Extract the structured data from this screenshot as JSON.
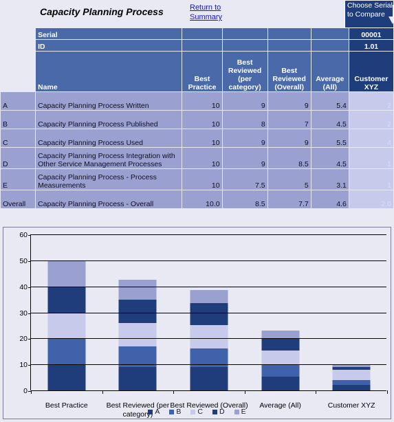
{
  "header": {
    "title": "Capacity Planning Process",
    "return_link": "Return to Summary",
    "choose_box_label": "Choose Serial to Compare",
    "arrow_icon": "arrow-down-icon"
  },
  "table": {
    "serial_row": {
      "label": "Serial",
      "value": "00001"
    },
    "id_row": {
      "label": "ID",
      "value": "1.01"
    },
    "columns": [
      {
        "key": "key",
        "label": ""
      },
      {
        "key": "name",
        "label": "Name"
      },
      {
        "key": "best_practice",
        "label": "Best Practice"
      },
      {
        "key": "best_reviewed_category",
        "label": "Best Reviewed (per category)"
      },
      {
        "key": "best_reviewed_overall",
        "label": "Best Reviewed (Overall)"
      },
      {
        "key": "average_all",
        "label": "Average (All)"
      },
      {
        "key": "customer_xyz",
        "label": "Customer XYZ"
      }
    ],
    "rows": [
      {
        "key": "A",
        "name": "Capacity Planning Process Written",
        "best_practice": "10",
        "best_reviewed_category": "9",
        "best_reviewed_overall": "9",
        "average_all": "5.4",
        "customer_xyz": "2"
      },
      {
        "key": "B",
        "name": "Capacity Planning Process Published",
        "best_practice": "10",
        "best_reviewed_category": "8",
        "best_reviewed_overall": "7",
        "average_all": "4.5",
        "customer_xyz": "2"
      },
      {
        "key": "C",
        "name": "Capacity Planning Process Used",
        "best_practice": "10",
        "best_reviewed_category": "9",
        "best_reviewed_overall": "9",
        "average_all": "5.5",
        "customer_xyz": "4"
      },
      {
        "key": "D",
        "name": "Capacity Planning Process Integration with Other Service Management Processes",
        "best_practice": "10",
        "best_reviewed_category": "9",
        "best_reviewed_overall": "8.5",
        "average_all": "4.5",
        "customer_xyz": "1"
      },
      {
        "key": "E",
        "name": "Capacity Planning Process - Process Measurements",
        "best_practice": "10",
        "best_reviewed_category": "7.5",
        "best_reviewed_overall": "5",
        "average_all": "3.1",
        "customer_xyz": "1"
      },
      {
        "key": "Overall",
        "name": "Capacity Planning Process - Overall",
        "best_practice": "10.0",
        "best_reviewed_category": "8.5",
        "best_reviewed_overall": "7.7",
        "average_all": "4.6",
        "customer_xyz": "2.0"
      }
    ]
  },
  "chart_data": {
    "type": "bar",
    "stacked": true,
    "title": "",
    "xlabel": "",
    "ylabel": "",
    "ylim": [
      0,
      60
    ],
    "yticks": [
      0,
      10,
      20,
      30,
      40,
      50,
      60
    ],
    "grid": true,
    "legend_position": "bottom",
    "categories": [
      "Best Practice",
      "Best Reviewed (per category)",
      "Best Reviewed (Overall)",
      "Average (All)",
      "Customer XYZ"
    ],
    "series": [
      {
        "name": "A",
        "color": "#1f3d7a",
        "values": [
          10,
          9,
          9,
          5.4,
          2
        ]
      },
      {
        "name": "B",
        "color": "#4062ab",
        "values": [
          10,
          8,
          7,
          4.5,
          2
        ]
      },
      {
        "name": "C",
        "color": "#c7caea",
        "values": [
          10,
          9,
          9,
          5.5,
          4
        ]
      },
      {
        "name": "D",
        "color": "#1f3d7a",
        "values": [
          10,
          9,
          8.5,
          4.5,
          1
        ]
      },
      {
        "name": "E",
        "color": "#9aa0cf",
        "values": [
          10,
          7.5,
          5,
          3.1,
          1
        ]
      }
    ],
    "totals": [
      50,
      42.5,
      38.5,
      23,
      10
    ]
  },
  "colors": {
    "background": "#e8e9f3",
    "header_blue": "#4a69a8",
    "header_dark": "#1f3d7a",
    "row_fill": "#9aa0cf",
    "customer_fill": "#c7caea",
    "link": "#1414d2"
  }
}
